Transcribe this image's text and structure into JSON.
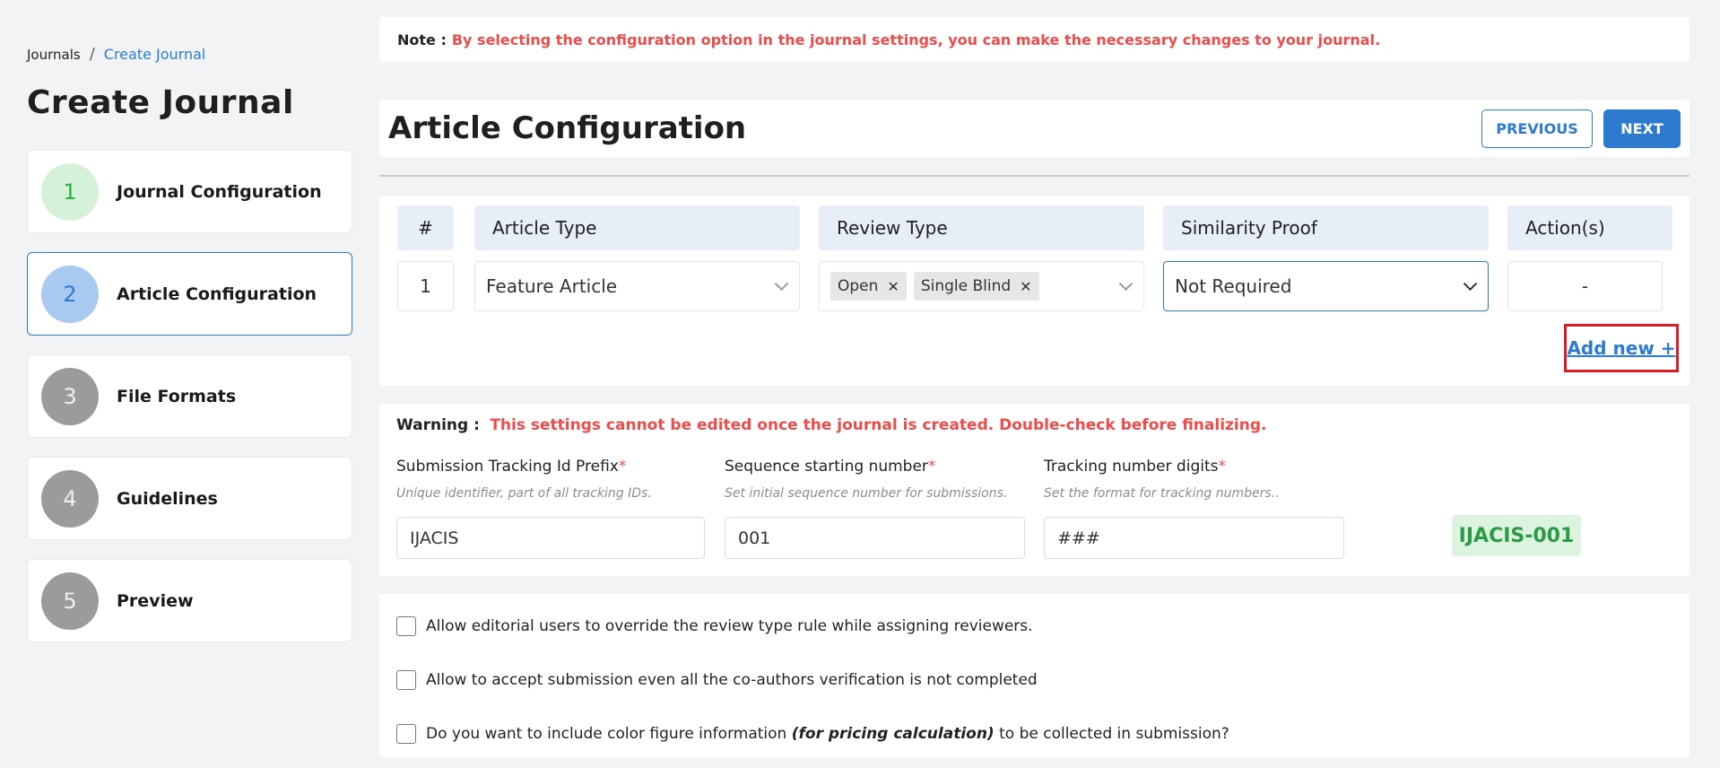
{
  "breadcrumb": {
    "root": "Journals",
    "separator": "/",
    "current": "Create Journal"
  },
  "page_title": "Create Journal",
  "steps": [
    {
      "number": "1",
      "label": "Journal Configuration",
      "state": "done"
    },
    {
      "number": "2",
      "label": "Article Configuration",
      "state": "current"
    },
    {
      "number": "3",
      "label": "File Formats",
      "state": "todo"
    },
    {
      "number": "4",
      "label": "Guidelines",
      "state": "todo"
    },
    {
      "number": "5",
      "label": "Preview",
      "state": "todo"
    }
  ],
  "note": {
    "label": "Note :",
    "text": "By selecting the configuration option in the journal settings, you can make the necessary changes to your journal."
  },
  "section": {
    "title": "Article Configuration",
    "previous_label": "PREVIOUS",
    "next_label": "NEXT"
  },
  "table": {
    "headers": {
      "index": "#",
      "article_type": "Article Type",
      "review_type": "Review Type",
      "similarity_proof": "Similarity Proof",
      "actions": "Action(s)"
    },
    "row": {
      "index": "1",
      "article_type": "Feature Article",
      "review_chips": [
        "Open",
        "Single Blind"
      ],
      "similarity_proof": "Not Required",
      "action": "-"
    },
    "add_new_label": "Add new +"
  },
  "warning": {
    "label": "Warning :",
    "text": "This settings cannot be edited once the journal is created. Double-check before finalizing."
  },
  "fields": {
    "prefix": {
      "label": "Submission Tracking Id Prefix",
      "help": "Unique identifier, part of all tracking IDs.",
      "value": "IJACIS"
    },
    "sequence": {
      "label": "Sequence starting number",
      "help": "Set initial sequence number for submissions.",
      "value": "001"
    },
    "digits": {
      "label": "Tracking number digits",
      "help": "Set the format for tracking numbers..",
      "value": "###"
    },
    "required_mark": "*",
    "preview": "IJACIS-001"
  },
  "options": {
    "override": "Allow editorial users to override the review type rule while assigning reviewers.",
    "accept": "Allow to accept submission even all the co-authors verification is not completed",
    "color_pre": "Do you want to include color figure information",
    "color_em": "(for pricing calculation)",
    "color_post": "to be collected in submission?"
  },
  "colors": {
    "primary": "#2d7bd0",
    "danger": "#ee4b4b",
    "success": "#2b9a45",
    "highlight": "#e01b24"
  }
}
